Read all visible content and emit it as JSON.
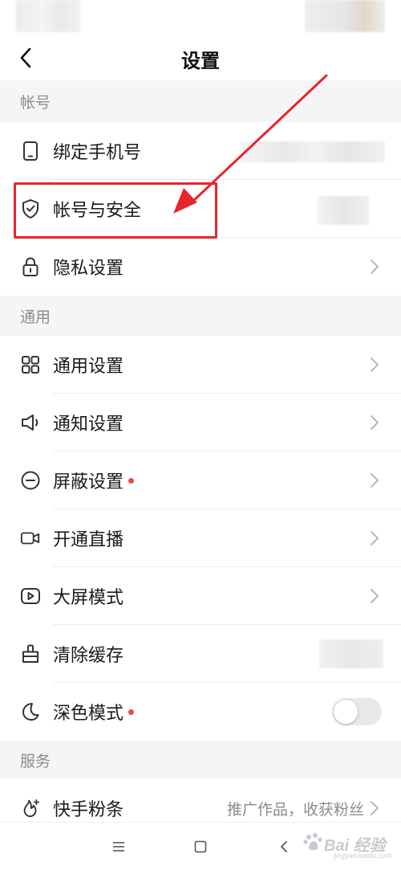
{
  "nav": {
    "title": "设置",
    "back_icon": "chevron-left-icon"
  },
  "sections": {
    "account": "帐号",
    "general": "通用",
    "services": "服务"
  },
  "rows": {
    "bind_phone": {
      "label": "绑定手机号",
      "icon": "phone-icon"
    },
    "account_security": {
      "label": "帐号与安全",
      "icon": "shield-icon"
    },
    "privacy": {
      "label": "隐私设置",
      "icon": "lock-icon"
    },
    "general_settings": {
      "label": "通用设置",
      "icon": "grid-icon"
    },
    "notification": {
      "label": "通知设置",
      "icon": "speaker-icon"
    },
    "block": {
      "label": "屏蔽设置",
      "icon": "minus-circle-icon",
      "badge": true
    },
    "live": {
      "label": "开通直播",
      "icon": "video-camera-icon"
    },
    "large_screen": {
      "label": "大屏模式",
      "icon": "play-icon"
    },
    "clear_cache": {
      "label": "清除缓存",
      "icon": "broom-icon"
    },
    "dark_mode": {
      "label": "深色模式",
      "icon": "moon-icon",
      "badge": true,
      "toggle_on": false
    },
    "fans": {
      "label": "快手粉条",
      "icon": "fire-plus-icon",
      "hint": "推广作品，收获粉丝"
    }
  },
  "bottom_nav": {
    "menu_icon": "menu-icon",
    "home_icon": "square-icon",
    "back_icon": "back-triangle-icon"
  },
  "watermark": {
    "text": "Bai 经验",
    "sub": "jingyan.baidu.com"
  },
  "colors": {
    "highlight": "#e8252b",
    "badge": "#f04848",
    "section_bg": "#f5f5f5"
  }
}
